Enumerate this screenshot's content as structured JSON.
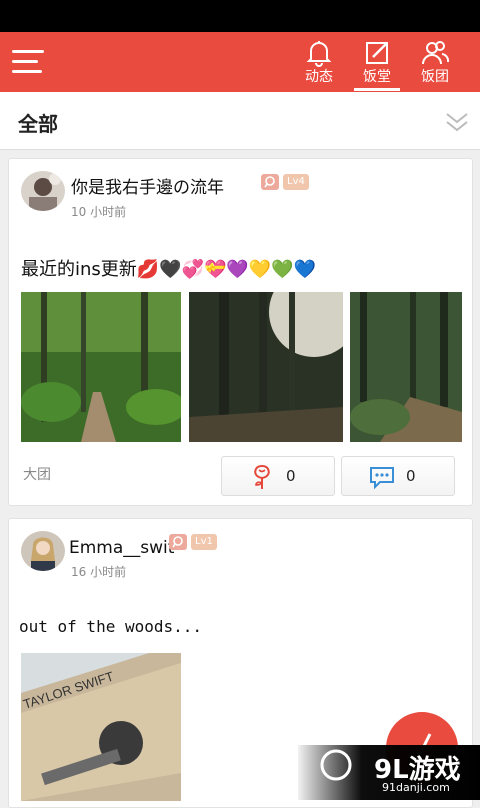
{
  "header": {
    "tabs": [
      {
        "label": "动态",
        "icon": "bell-icon",
        "active": false
      },
      {
        "label": "饭堂",
        "icon": "edit-icon",
        "active": true
      },
      {
        "label": "饭团",
        "icon": "users-icon",
        "active": false
      }
    ],
    "accent": "#e94b3f"
  },
  "filter": {
    "label": "全部"
  },
  "posts": [
    {
      "user": "你是我右手邊の流年",
      "level": "Lv4",
      "time": "10 小时前",
      "text": "最近的ins更新💋🖤💞💝💜💛💚💙",
      "group": "大团",
      "likes": "0",
      "comments": "0"
    },
    {
      "user": "Emma__swit",
      "level": "Lv1",
      "time": "16 小时前",
      "text": "out of the woods...",
      "guitar_text": "TAYLOR SWIFT"
    }
  ],
  "watermark": {
    "brand": "9L游戏",
    "url": "91danji.com"
  }
}
